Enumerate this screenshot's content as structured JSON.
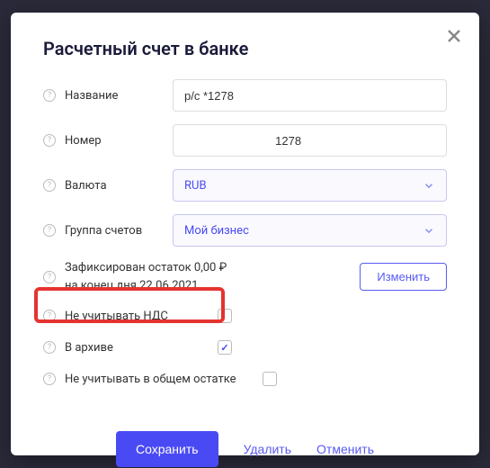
{
  "modal": {
    "title": "Расчетный счет в банке",
    "fields": {
      "name": {
        "label": "Название",
        "value": "р/с *1278"
      },
      "number": {
        "label": "Номер",
        "value": "                            1278"
      },
      "currency": {
        "label": "Валюта",
        "selected": "RUB"
      },
      "group": {
        "label": "Группа счетов",
        "selected": "Мой бизнес"
      }
    },
    "balance": {
      "line1": "Зафиксирован остаток 0,00 ₽",
      "line2": "на конец дня 22.06.2021",
      "change": "Изменить"
    },
    "checkboxes": {
      "ignore_vat": {
        "label": "Не учитывать НДС",
        "checked": false
      },
      "archived": {
        "label": "В архиве",
        "checked": true
      },
      "ignore_total": {
        "label": "Не учитывать в общем остатке",
        "checked": false
      }
    },
    "actions": {
      "save": "Сохранить",
      "delete": "Удалить",
      "cancel": "Отменить"
    }
  }
}
